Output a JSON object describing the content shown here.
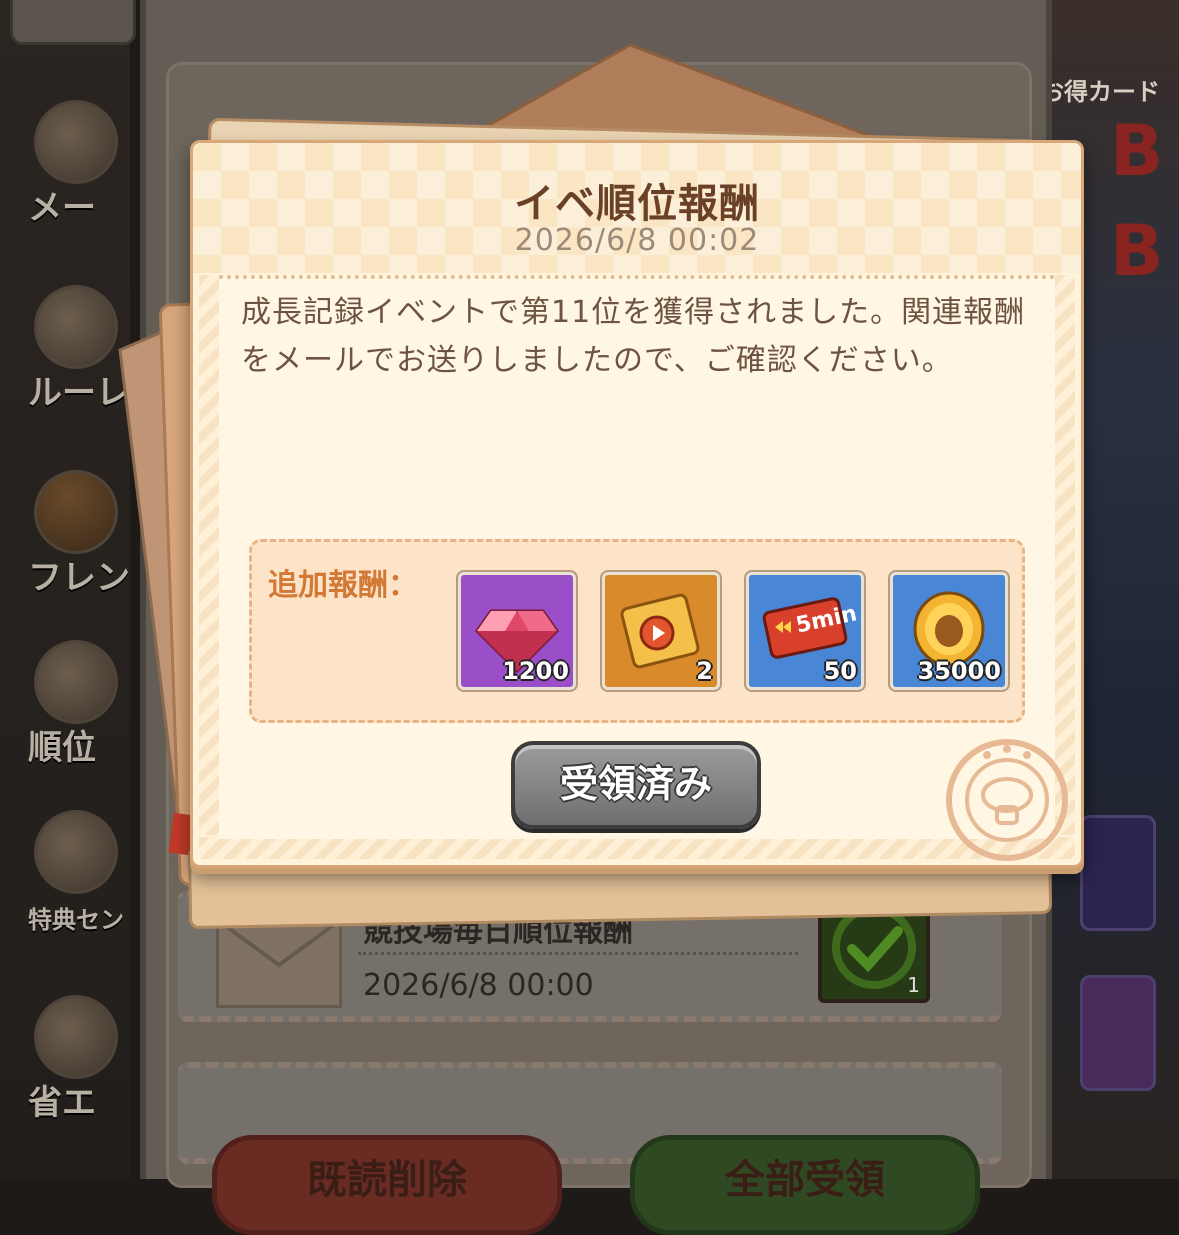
{
  "sidebar": {
    "items": [
      {
        "label": "メー",
        "icon": "mail-icon"
      },
      {
        "label": "ルーレ",
        "icon": "roulette-icon"
      },
      {
        "label": "フレン",
        "icon": "friend-mushroom-icon"
      },
      {
        "label": "順位",
        "icon": "ranking-trophy-icon"
      },
      {
        "label": "特典セン",
        "icon": "treasure-chest-icon"
      },
      {
        "label": "省エ",
        "icon": "power-save-icon"
      }
    ]
  },
  "right_panel": {
    "promo_label": "お得カード"
  },
  "background_mail": {
    "title": "競技場毎日順位報酬",
    "date": "2026/6/8  00:00",
    "count": "1"
  },
  "background_buttons": {
    "delete_label": "既読削除",
    "claim_all_label": "全部受領"
  },
  "modal": {
    "title": "イベ順位報酬",
    "date": "2026/6/8  00:02",
    "message": "成長記録イベントで第11位を獲得されました。関連報酬をメールでお送りしましたので、ご確認ください。",
    "reward_label": "追加報酬：",
    "rewards": [
      {
        "icon": "ruby-gem-icon",
        "quantity": "1200",
        "bg": "#9a4fc8"
      },
      {
        "icon": "golden-ticket-icon",
        "quantity": "2",
        "bg": "#d98a2b"
      },
      {
        "icon": "speedup-5min-ticket-icon",
        "quantity": "50",
        "bg": "#4a86d6",
        "badge": "5min"
      },
      {
        "icon": "gold-coin-icon",
        "quantity": "35000",
        "bg": "#4a86d6"
      }
    ],
    "claim_button_label": "受領済み"
  }
}
